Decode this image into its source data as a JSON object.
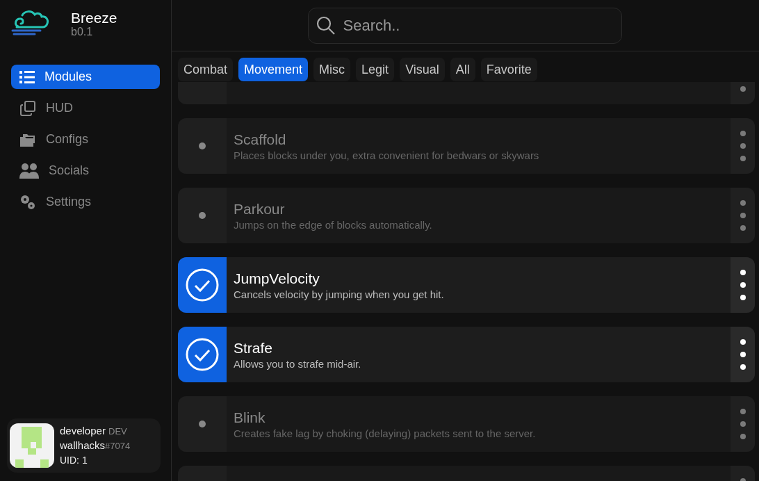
{
  "app": {
    "name": "Breeze",
    "version": "b0.1"
  },
  "search": {
    "placeholder": "Search.."
  },
  "nav": [
    {
      "label": "Modules",
      "selected": true
    },
    {
      "label": "HUD",
      "selected": false
    },
    {
      "label": "Configs",
      "selected": false
    },
    {
      "label": "Socials",
      "selected": false
    },
    {
      "label": "Settings",
      "selected": false
    }
  ],
  "user": {
    "name": "developer",
    "role": "DEV",
    "handle": "wallhacks",
    "tag": "#7074",
    "uid": "UID: 1"
  },
  "tabs": [
    {
      "label": "Combat",
      "selected": false
    },
    {
      "label": "Movement",
      "selected": true
    },
    {
      "label": "Misc",
      "selected": false
    },
    {
      "label": "Legit",
      "selected": false
    },
    {
      "label": "Visual",
      "selected": false
    },
    {
      "label": "All",
      "selected": false
    },
    {
      "label": "Favorite",
      "selected": false
    }
  ],
  "modules": [
    {
      "enabled": false
    },
    {
      "name": "Scaffold",
      "description": "Places blocks under you, extra convenient for bedwars or skywars",
      "enabled": false
    },
    {
      "name": "Parkour",
      "description": "Jumps on the edge of blocks automatically.",
      "enabled": false
    },
    {
      "name": "JumpVelocity",
      "description": "Cancels velocity by jumping when you get hit.",
      "enabled": true
    },
    {
      "name": "Strafe",
      "description": "Allows you to strafe mid-air.",
      "enabled": true
    },
    {
      "name": "Blink",
      "description": "Creates fake lag by choking (delaying) packets sent to the server.",
      "enabled": false
    },
    {
      "enabled": false
    }
  ]
}
